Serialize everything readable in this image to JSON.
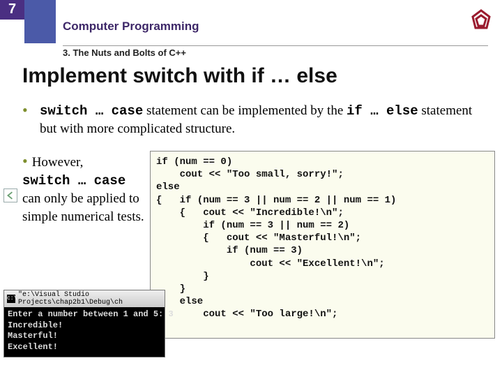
{
  "page_number": "7",
  "course": "Computer Programming",
  "chapter": "3. The Nuts and Bolts of C++",
  "slide_title": "Implement switch with if … else",
  "bullet1": {
    "pre": "switch … case",
    "mid": " statement can be implemented by the ",
    "code2": "if … else",
    "post": " statement but with more complicated structure."
  },
  "bullet2": {
    "l1": "However,",
    "code": "switch … case",
    "l2": " can only be applied to simple numerical tests."
  },
  "code": "if (num == 0)\n    cout << \"Too small, sorry!\";\nelse\n{   if (num == 3 || num == 2 || num == 1)\n    {   cout << \"Incredible!\\n\";\n        if (num == 3 || num == 2)\n        {   cout << \"Masterful!\\n\";\n            if (num == 3)\n                cout << \"Excellent!\\n\";\n        }\n    }\n    else\n        cout << \"Too large!\\n\";\n}",
  "console": {
    "title": "\"e:\\Visual Studio Projects\\chap2b1\\Debug\\ch",
    "output": "Enter a number between 1 and 5: 3\nIncredible!\nMasterful!\nExcellent!"
  }
}
